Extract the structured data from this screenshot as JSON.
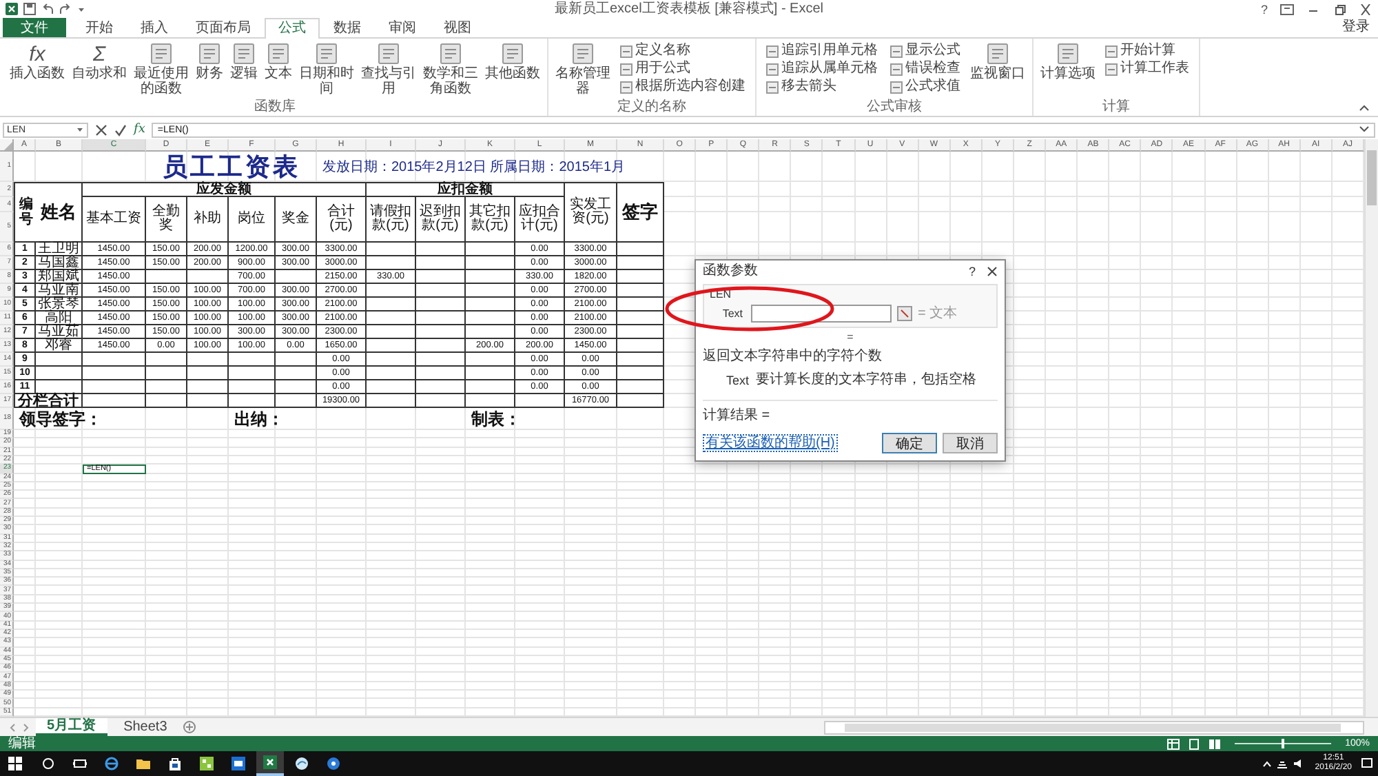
{
  "title_bar": {
    "title": "最新员工excel工资表模板 [兼容模式] - Excel",
    "help": "?"
  },
  "ribbon_tabs": [
    {
      "label": "文件",
      "kind": "file",
      "selected": false
    },
    {
      "label": "开始",
      "kind": "tab",
      "selected": false
    },
    {
      "label": "插入",
      "kind": "tab",
      "selected": false
    },
    {
      "label": "页面布局",
      "kind": "tab",
      "selected": false
    },
    {
      "label": "公式",
      "kind": "tab",
      "selected": true
    },
    {
      "label": "数据",
      "kind": "tab",
      "selected": false
    },
    {
      "label": "审阅",
      "kind": "tab",
      "selected": false
    },
    {
      "label": "视图",
      "kind": "tab",
      "selected": false
    }
  ],
  "sign_in": "登录",
  "ribbon_groups": [
    {
      "label": "函数库",
      "items": [
        {
          "kind": "large",
          "label": "插入函数",
          "glyph": "fx"
        },
        {
          "kind": "large",
          "label": "自动求和",
          "glyph": "Σ"
        },
        {
          "kind": "large",
          "label": "最近使用的函数"
        },
        {
          "kind": "large",
          "label": "财务"
        },
        {
          "kind": "large",
          "label": "逻辑"
        },
        {
          "kind": "large",
          "label": "文本"
        },
        {
          "kind": "large",
          "label": "日期和时间"
        },
        {
          "kind": "large",
          "label": "查找与引用"
        },
        {
          "kind": "large",
          "label": "数学和三角函数"
        },
        {
          "kind": "large",
          "label": "其他函数"
        }
      ]
    },
    {
      "label": "定义的名称",
      "items": [
        {
          "kind": "large",
          "label": "名称管理器"
        },
        {
          "kind": "small",
          "label": "定义名称"
        },
        {
          "kind": "small",
          "label": "用于公式"
        },
        {
          "kind": "small",
          "label": "根据所选内容创建"
        }
      ]
    },
    {
      "label": "公式审核",
      "items": [
        {
          "kind": "small",
          "label": "追踪引用单元格"
        },
        {
          "kind": "small",
          "label": "追踪从属单元格"
        },
        {
          "kind": "small",
          "label": "移去箭头"
        },
        {
          "kind": "small",
          "label": "显示公式"
        },
        {
          "kind": "small",
          "label": "错误检查"
        },
        {
          "kind": "small",
          "label": "公式求值"
        },
        {
          "kind": "large",
          "label": "监视窗口"
        }
      ]
    },
    {
      "label": "计算",
      "items": [
        {
          "kind": "large",
          "label": "计算选项"
        },
        {
          "kind": "small",
          "label": "开始计算"
        },
        {
          "kind": "small",
          "label": "计算工作表"
        }
      ]
    }
  ],
  "formula_bar": {
    "name_box": "LEN",
    "fx": "fx",
    "formula": "=LEN()"
  },
  "columns": [
    "A",
    "B",
    "C",
    "D",
    "E",
    "F",
    "G",
    "H",
    "I",
    "J",
    "K",
    "L",
    "M",
    "N",
    "O",
    "P",
    "Q",
    "R",
    "S",
    "T",
    "U",
    "V",
    "W",
    "X",
    "Y",
    "Z",
    "AA",
    "AB",
    "AC",
    "AD",
    "AE",
    "AF",
    "AG",
    "AH",
    "AI",
    "AJ"
  ],
  "row_numbers": [
    "1",
    "2",
    "4",
    "5",
    "6",
    "7",
    "8",
    "9",
    "10",
    "11",
    "12",
    "13",
    "14",
    "15",
    "16",
    "17",
    "18",
    "19",
    "20",
    "21",
    "22",
    "23",
    "24",
    "25",
    "26",
    "27",
    "28",
    "29",
    "30",
    "31",
    "32",
    "33",
    "34",
    "35",
    "36",
    "37",
    "38",
    "39",
    "40",
    "41",
    "42",
    "43",
    "44",
    "45",
    "46",
    "47",
    "48",
    "49",
    "50",
    "51"
  ],
  "sheet": {
    "title": "员工工资表",
    "dates": "发放日期：2015年2月12日  所属日期：2015年1月",
    "header": {
      "number": "编号",
      "name": "姓名",
      "groups": [
        {
          "label": "应发金额",
          "columns": [
            "基本工资",
            "全勤奖",
            "补助",
            "岗位",
            "奖金",
            "合计(元)"
          ]
        },
        {
          "label": "应扣金额",
          "columns": [
            "请假扣款(元)",
            "迟到扣款(元)",
            "其它扣款(元)",
            "应扣合计(元)"
          ]
        }
      ],
      "net_pay": "实发工资(元)",
      "signature": "签字"
    },
    "rows": [
      {
        "no": "1",
        "name": "王卫明",
        "base_pay": "1450.00",
        "attendance_bonus": "150.00",
        "allowance": "200.00",
        "position_pay": "1200.00",
        "bonus": "300.00",
        "gross_total": "3300.00",
        "deduction_total": "0.00",
        "net": "3300.00"
      },
      {
        "no": "2",
        "name": "马国鑫",
        "base_pay": "1450.00",
        "attendance_bonus": "150.00",
        "allowance": "200.00",
        "position_pay": "900.00",
        "bonus": "300.00",
        "gross_total": "3000.00",
        "deduction_total": "0.00",
        "net": "3000.00"
      },
      {
        "no": "3",
        "name": "郑国斌",
        "base_pay": "1450.00",
        "position_pay": "700.00",
        "gross_total": "2150.00",
        "leave_deduction": "330.00",
        "deduction_total": "330.00",
        "net": "1820.00"
      },
      {
        "no": "4",
        "name": "马亚南",
        "base_pay": "1450.00",
        "attendance_bonus": "150.00",
        "allowance": "100.00",
        "position_pay": "700.00",
        "bonus": "300.00",
        "gross_total": "2700.00",
        "deduction_total": "0.00",
        "net": "2700.00"
      },
      {
        "no": "5",
        "name": "张景琴",
        "base_pay": "1450.00",
        "attendance_bonus": "150.00",
        "allowance": "100.00",
        "position_pay": "100.00",
        "bonus": "300.00",
        "gross_total": "2100.00",
        "deduction_total": "0.00",
        "net": "2100.00"
      },
      {
        "no": "6",
        "name": "高阳",
        "base_pay": "1450.00",
        "attendance_bonus": "150.00",
        "allowance": "100.00",
        "position_pay": "100.00",
        "bonus": "300.00",
        "gross_total": "2100.00",
        "deduction_total": "0.00",
        "net": "2100.00"
      },
      {
        "no": "7",
        "name": "马亚茹",
        "base_pay": "1450.00",
        "attendance_bonus": "150.00",
        "allowance": "100.00",
        "position_pay": "300.00",
        "bonus": "300.00",
        "gross_total": "2300.00",
        "deduction_total": "0.00",
        "net": "2300.00"
      },
      {
        "no": "8",
        "name": "邓睿",
        "base_pay": "1450.00",
        "attendance_bonus": "0.00",
        "allowance": "100.00",
        "position_pay": "100.00",
        "bonus": "0.00",
        "gross_total": "1650.00",
        "other_deduction": "200.00",
        "deduction_total": "200.00",
        "net": "1450.00"
      },
      {
        "no": "9",
        "gross_total": "0.00",
        "deduction_total": "0.00",
        "net": "0.00"
      },
      {
        "no": "10",
        "gross_total": "0.00",
        "deduction_total": "0.00",
        "net": "0.00"
      },
      {
        "no": "11",
        "gross_total": "0.00",
        "deduction_total": "0.00",
        "net": "0.00"
      }
    ],
    "totals": {
      "label": "分栏合计",
      "gross": "19300.00",
      "net": "16770.00"
    },
    "signatures": [
      "领导签字：",
      "出纳：",
      "制表："
    ]
  },
  "active_cell": {
    "value": "=LEN()"
  },
  "dialog": {
    "title": "函数参数",
    "help": "?",
    "function": "LEN",
    "argument": "Text",
    "argument_value": "= 文本",
    "result_eq": "=",
    "description": "返回文本字符串中的字符个数",
    "param_name": "Text",
    "param_description": "要计算长度的文本字符串，包括空格",
    "result": "计算结果 =",
    "help_link": "有关该函数的帮助(H)",
    "buttons": [
      "确定",
      "取消"
    ]
  },
  "sheet_tabs": [
    {
      "label": "5月工资",
      "selected": true
    },
    {
      "label": "Sheet3",
      "selected": false
    }
  ],
  "status_bar": {
    "mode": "编辑",
    "zoom_slider": {
      "level": 0.5
    },
    "zoom": "100%"
  },
  "taskbar": {
    "apps": [
      {
        "kind": "search",
        "selected": false
      },
      {
        "kind": "task-view",
        "selected": false
      },
      {
        "kind": "browser",
        "selected": false
      },
      {
        "kind": "folder",
        "selected": false
      },
      {
        "kind": "store",
        "selected": false
      },
      {
        "kind": "grid-app",
        "selected": false
      },
      {
        "kind": "window-app",
        "selected": false
      },
      {
        "kind": "spreadsheet",
        "selected": true
      },
      {
        "kind": "bird",
        "selected": false
      },
      {
        "kind": "help",
        "selected": false
      }
    ],
    "time": "12:51",
    "date": "2016/2/20"
  }
}
